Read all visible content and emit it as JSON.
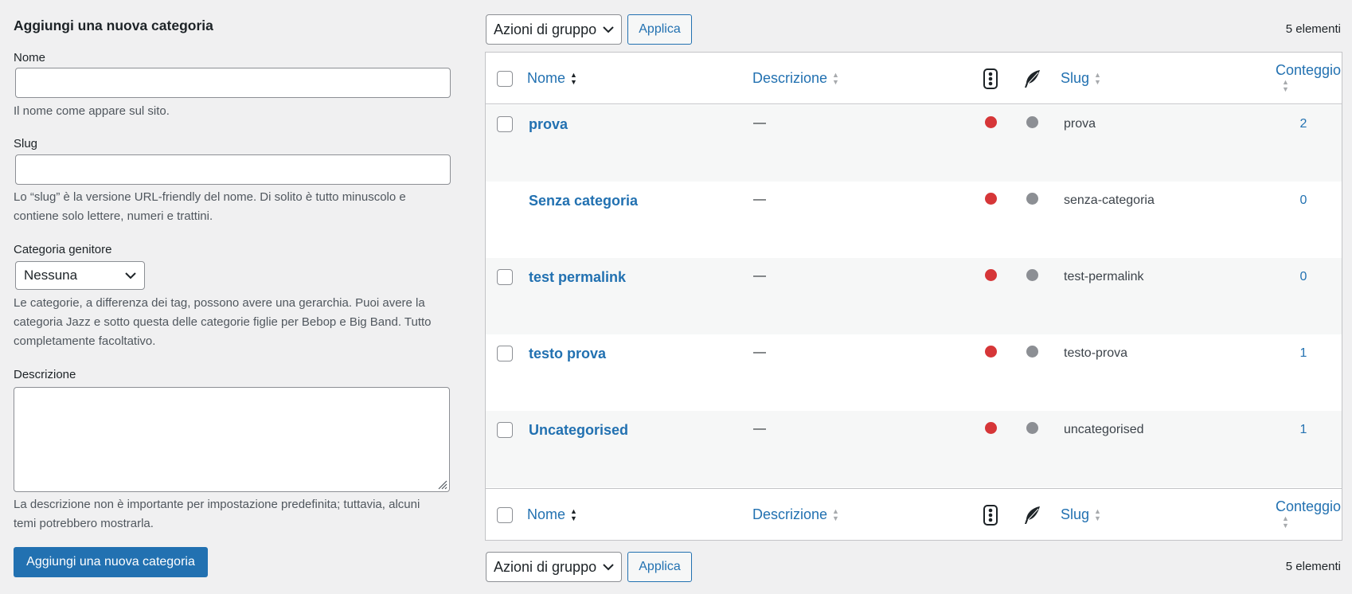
{
  "form": {
    "title": "Aggiungi una nuova categoria",
    "name_label": "Nome",
    "name_value": "",
    "name_help": "Il nome come appare sul sito.",
    "slug_label": "Slug",
    "slug_value": "",
    "slug_help": "Lo “slug” è la versione URL-friendly del nome. Di solito è tutto minuscolo e contiene solo lettere, numeri e trattini.",
    "parent_label": "Categoria genitore",
    "parent_value": "Nessuna",
    "parent_help": "Le categorie, a differenza dei tag, possono avere una gerarchia. Puoi avere la categoria Jazz e sotto questa delle categorie figlie per Bebop e Big Band. Tutto completamente facoltativo.",
    "description_label": "Descrizione",
    "description_value": "",
    "description_help": "La descrizione non è importante per impostazione predefinita; tuttavia, alcuni temi potrebbero mostrarla.",
    "submit_label": "Aggiungi una nuova categoria"
  },
  "toolbar": {
    "bulk_actions": "Azioni di gruppo",
    "apply": "Applica",
    "items_count": "5 elementi"
  },
  "columns": {
    "name": "Nome",
    "description": "Descrizione",
    "status_icon": "traffic-light-icon",
    "seo_icon": "feather-icon",
    "slug": "Slug",
    "count": "Conteggio"
  },
  "rows": [
    {
      "name": "prova",
      "description": "—",
      "slug": "prova",
      "count": "2",
      "has_checkbox": true
    },
    {
      "name": "Senza categoria",
      "description": "—",
      "slug": "senza-categoria",
      "count": "0",
      "has_checkbox": false
    },
    {
      "name": "test permalink",
      "description": "—",
      "slug": "test-permalink",
      "count": "0",
      "has_checkbox": true
    },
    {
      "name": "testo prova",
      "description": "—",
      "slug": "testo-prova",
      "count": "1",
      "has_checkbox": true
    },
    {
      "name": "Uncategorised",
      "description": "—",
      "slug": "uncategorised",
      "count": "1",
      "has_checkbox": true
    }
  ],
  "colors": {
    "link": "#2271b1",
    "status_red": "#d63638",
    "status_grey": "#8c8f94"
  }
}
